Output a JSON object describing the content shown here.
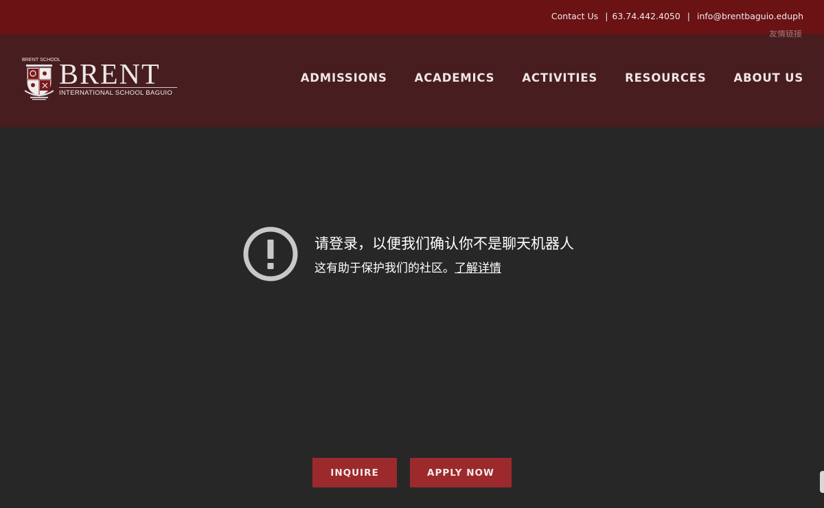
{
  "topbar": {
    "contact_label": "Contact Us",
    "phone": "63.74.442.4050",
    "email": "info@brentbaguio.eduph",
    "separator": "|"
  },
  "header": {
    "faint_text": "友情链接",
    "logo": {
      "crest_caption": "BRENT SCHOOL",
      "wordmark": "BRENT",
      "subtitle": "INTERNATIONAL SCHOOL BAGUIO"
    },
    "nav": [
      {
        "label": "ADMISSIONS"
      },
      {
        "label": "ACADEMICS"
      },
      {
        "label": "ACTIVITIES"
      },
      {
        "label": "RESOURCES"
      },
      {
        "label": "ABOUT US"
      }
    ]
  },
  "notice": {
    "icon": "alert-circle-icon",
    "title": "请登录，以便我们确认你不是聊天机器人",
    "subtitle": "这有助于保护我们的社区。",
    "learn_more": "了解详情"
  },
  "cta": {
    "inquire": "INQUIRE",
    "apply": "APPLY NOW"
  },
  "colors": {
    "topbar": "#6a1214",
    "header": "#481d1f",
    "body": "#272727",
    "button": "#9c2a2c",
    "icon": "#c8c8c8"
  }
}
